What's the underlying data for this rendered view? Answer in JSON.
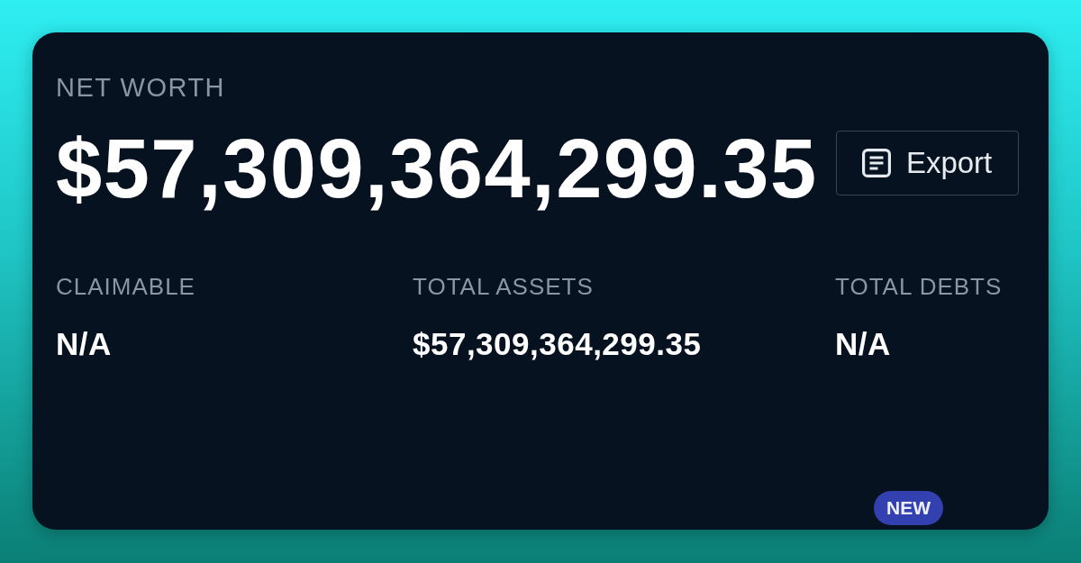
{
  "card": {
    "title": "NET WORTH",
    "value": "$57,309,364,299.35",
    "export_button": {
      "label": "Export"
    },
    "stats": [
      {
        "label": "CLAIMABLE",
        "value": "N/A"
      },
      {
        "label": "TOTAL ASSETS",
        "value": "$57,309,364,299.35"
      },
      {
        "label": "TOTAL DEBTS",
        "value": "N/A"
      }
    ],
    "badge": "NEW"
  }
}
